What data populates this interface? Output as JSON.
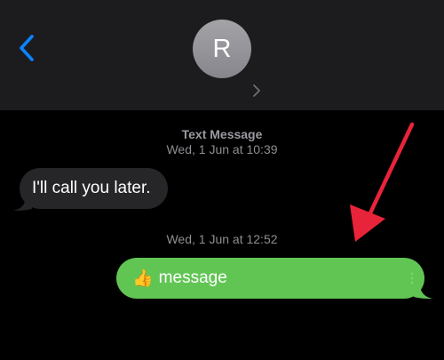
{
  "header": {
    "contact_initial": "R",
    "back_icon": "chevron-left-icon",
    "contact_chevron_icon": "chevron-right-icon"
  },
  "thread": {
    "service_label": "Text Message",
    "timestamp_1": "Wed, 1 Jun at 10:39",
    "received_message": "I'll call you later.",
    "timestamp_2": "Wed, 1 Jun at 12:52",
    "sent_message_emoji": "👍",
    "sent_message_text": "message"
  },
  "colors": {
    "header_bg": "#1c1c1e",
    "accent_blue": "#0a84ff",
    "received_bubble": "#262629",
    "sent_bubble": "#61c554",
    "annotation_arrow": "#e8243a"
  }
}
